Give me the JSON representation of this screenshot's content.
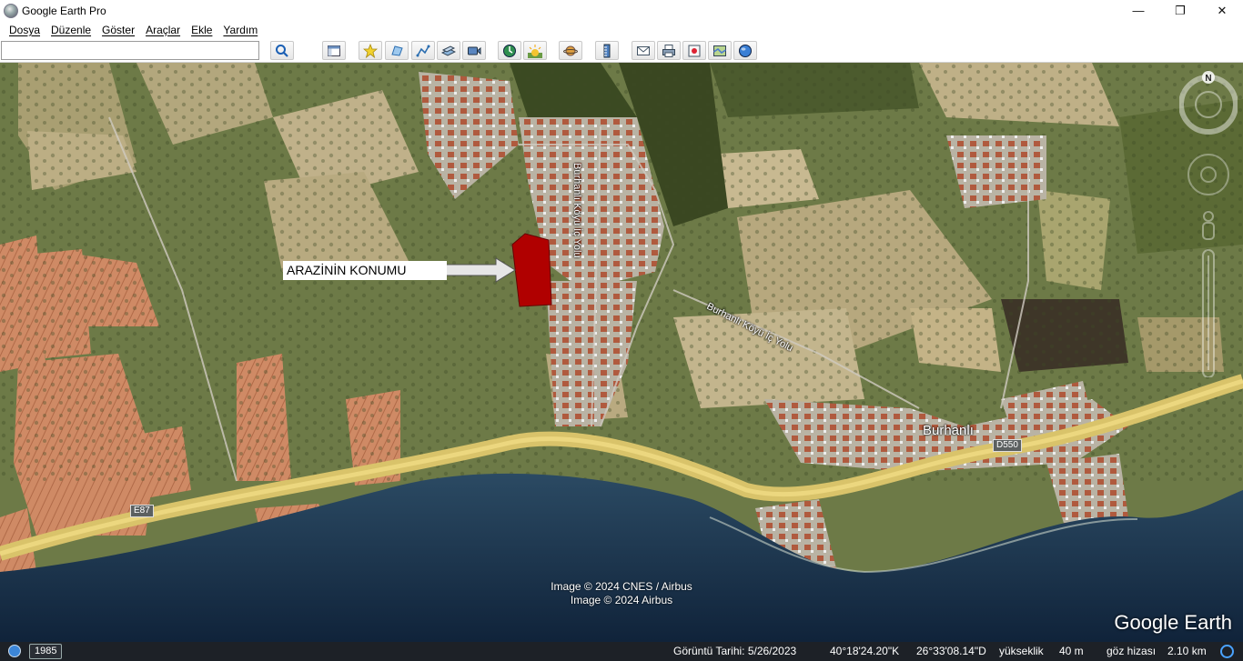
{
  "window": {
    "title": "Google Earth Pro",
    "controls": {
      "minimize": "—",
      "maximize": "❐",
      "close": "✕"
    }
  },
  "menu": [
    "Dosya",
    "Düzenle",
    "Göster",
    "Araçlar",
    "Ekle",
    "Yardım"
  ],
  "search": {
    "value": "",
    "placeholder": ""
  },
  "toolbar": {
    "icons": [
      "search-icon",
      "sidebar-toggle-icon",
      "placemark-icon",
      "polygon-icon",
      "path-icon",
      "image-overlay-icon",
      "record-tour-icon",
      "historical-imagery-icon",
      "sun-icon",
      "planets-icon",
      "ruler-icon",
      "email-icon",
      "print-icon",
      "save-image-icon",
      "map-view-icon",
      "web-icon"
    ]
  },
  "map": {
    "annotation": "ARAZİNİN KONUMU",
    "labels": {
      "village": "Burhanlı",
      "road_a": "Burhanlı Köyü İç Yolu",
      "road_b": "Burhanlı Köyü İç Yolu",
      "highway_d": "D550",
      "highway_e": "E87"
    },
    "copyright": [
      "Image © 2024 CNES / Airbus",
      "Image © 2024 Airbus"
    ],
    "logo": "Google Earth",
    "colors": {
      "parcel": "#b30000",
      "highway": "#e8c653",
      "sea": "#1f3a55"
    }
  },
  "status": {
    "year": "1985",
    "imagery_date": "Görüntü Tarihi: 5/26/2023",
    "lat": "40°18'24.20\"K",
    "lon": "26°33'08.14\"D",
    "elevation_label": "yükseklik",
    "elevation": "40 m",
    "eye_label": "göz hizası",
    "eye_alt": "2.10 km"
  }
}
